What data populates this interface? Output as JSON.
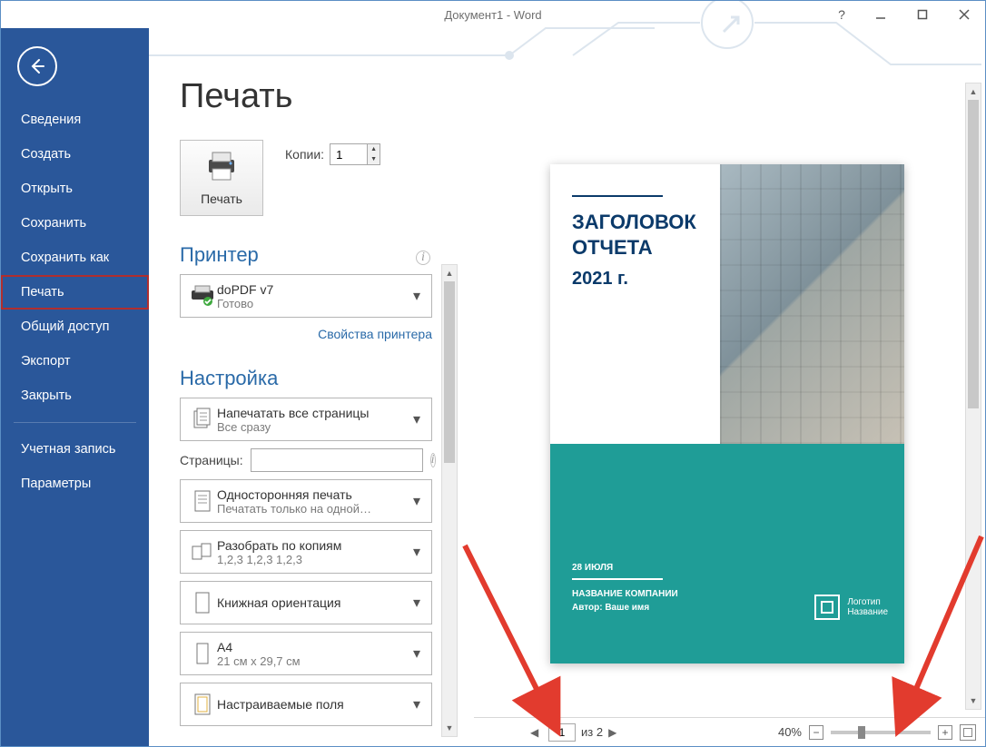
{
  "window": {
    "title": "Документ1 - Word"
  },
  "sidebar": {
    "items": [
      "Сведения",
      "Создать",
      "Открыть",
      "Сохранить",
      "Сохранить как",
      "Печать",
      "Общий доступ",
      "Экспорт",
      "Закрыть"
    ],
    "items2": [
      "Учетная запись",
      "Параметры"
    ],
    "active_index": 5
  },
  "page": {
    "title": "Печать"
  },
  "print": {
    "button_label": "Печать",
    "copies_label": "Копии:",
    "copies_value": "1"
  },
  "printer": {
    "section": "Принтер",
    "name": "doPDF v7",
    "status": "Готово",
    "properties_link": "Свойства принтера"
  },
  "settings": {
    "section": "Настройка",
    "range": {
      "line1": "Напечатать все страницы",
      "line2": "Все сразу"
    },
    "pages_label": "Страницы:",
    "pages_value": "",
    "sides": {
      "line1": "Односторонняя печать",
      "line2": "Печатать только на одной…"
    },
    "collate": {
      "line1": "Разобрать по копиям",
      "line2": "1,2,3    1,2,3    1,2,3"
    },
    "orientation": {
      "line1": "Книжная ориентация",
      "line2": ""
    },
    "paper": {
      "line1": "A4",
      "line2": "21 см x 29,7 см"
    },
    "margins": {
      "line1": "Настраиваемые поля",
      "line2": ""
    }
  },
  "preview": {
    "doc": {
      "title": "ЗАГОЛОВОК ОТЧЕТА",
      "year": "2021 г.",
      "date": "28 ИЮЛЯ",
      "company": "НАЗВАНИЕ КОМПАНИИ",
      "author": "Автор: Ваше имя",
      "logo_line1": "Логотип",
      "logo_line2": "Название"
    },
    "footer": {
      "page_current": "1",
      "page_of": "из 2",
      "zoom": "40%"
    }
  }
}
